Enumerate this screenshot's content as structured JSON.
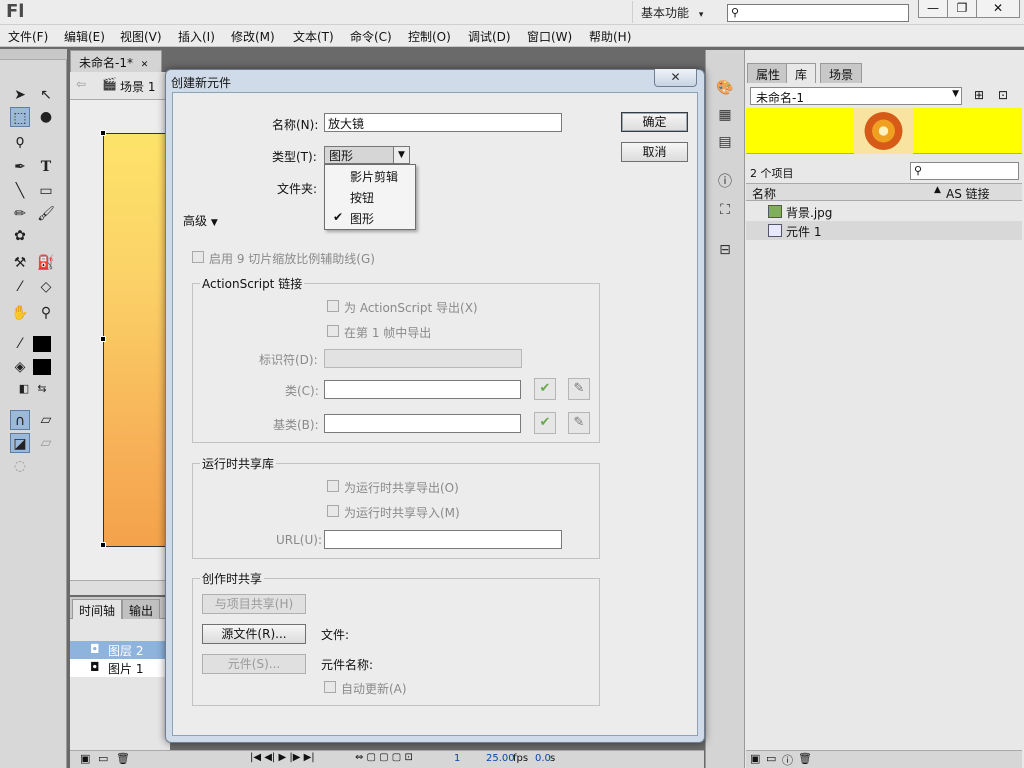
{
  "app": {
    "logo": "Fl",
    "workspace": "基本功能",
    "workspace_arrow": "▾",
    "window_buttons": [
      "—",
      "❐",
      "✕"
    ]
  },
  "menubar": {
    "items": [
      "文件(F)",
      "编辑(E)",
      "视图(V)",
      "插入(I)",
      "修改(M)",
      "文本(T)",
      "命令(C)",
      "控制(O)",
      "调试(D)",
      "窗口(W)",
      "帮助(H)"
    ]
  },
  "document": {
    "tab_label": "未命名-1*",
    "tab_close": "✕",
    "scene_label": "场景 1"
  },
  "timeline": {
    "tabs": [
      "时间轴",
      "输出"
    ],
    "layers": [
      "图层 2",
      "图片 1"
    ],
    "frame": "1",
    "fps": "25.00",
    "fps_unit": "fps",
    "time": "0.0",
    "time_unit": "s"
  },
  "right_panel": {
    "tabs": [
      "属性",
      "库",
      "场景"
    ],
    "library_name": "未命名-1",
    "item_count": "2 个项目",
    "col_name": "名称",
    "col_linkage": "AS 链接",
    "items": [
      {
        "name": "背景.jpg",
        "icon": "bitmap-icon"
      },
      {
        "name": "元件 1",
        "icon": "graphic-symbol-icon"
      }
    ]
  },
  "dialog": {
    "title": "创建新元件",
    "close": "✕",
    "name_label": "名称(N):",
    "name_value": "放大镜",
    "type_label": "类型(T):",
    "type_value": "图形",
    "folder_label": "文件夹:",
    "advanced_label": "高级",
    "ok_label": "确定",
    "cancel_label": "取消",
    "type_options": [
      {
        "label": "影片剪辑",
        "checked": false
      },
      {
        "label": "按钮",
        "checked": false
      },
      {
        "label": "图形",
        "checked": true
      }
    ],
    "nine_slice": "启用 9 切片缩放比例辅助线(G)",
    "as_group_title": "ActionScript 链接",
    "export_as": "为 ActionScript 导出(X)",
    "export_first_frame": "在第 1 帧中导出",
    "identifier_label": "标识符(D):",
    "class_label": "类(C):",
    "base_class_label": "基类(B):",
    "runtime_group_title": "运行时共享库",
    "runtime_export": "为运行时共享导出(O)",
    "runtime_import": "为运行时共享导入(M)",
    "url_label": "URL(U):",
    "author_group_title": "创作时共享",
    "share_with_project": "与项目共享(H)",
    "source_file_btn": "源文件(R)...",
    "file_label": "文件:",
    "symbol_btn": "元件(S)...",
    "symbol_name_label": "元件名称:",
    "auto_update": "自动更新(A)"
  }
}
